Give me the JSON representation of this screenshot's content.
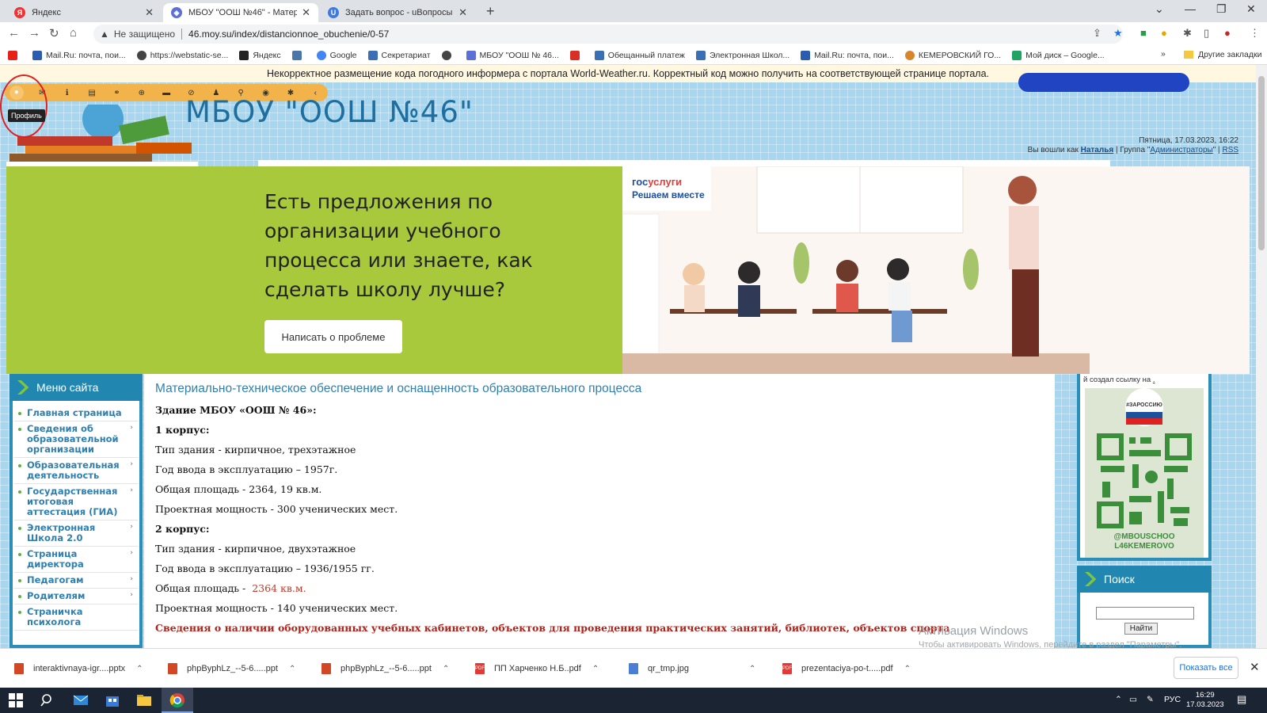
{
  "browser": {
    "tabs": [
      {
        "title": "Яндекс",
        "favicon": "yandex-icon",
        "color": "#e33"
      },
      {
        "title": "МБОУ \"ООШ №46\" - Материал...",
        "favicon": "site-icon",
        "color": "#5b6fd6"
      },
      {
        "title": "Задать вопрос - uВопросы",
        "favicon": "u-icon",
        "color": "#3d7be0"
      }
    ],
    "security_label": "Не защищено",
    "url": "46.moy.su/index/distancionnoe_obuchenie/0-57",
    "bookmarks": [
      "Mail.Ru: почта, пои...",
      "https://webstatic-se...",
      "Яндекс",
      "Google",
      "Секретариат",
      "МБОУ \"ООШ № 46...",
      "Обещанный платеж",
      "Электронная Школ...",
      "Mail.Ru: почта, пои...",
      "КЕМЕРОВСКИЙ ГО...",
      "Мой диск – Google..."
    ],
    "bookmarks_more": "»",
    "other_bookmarks": "Другие закладки"
  },
  "page": {
    "notice": "Некорректное размещение кода погодного информера с портала World-Weather.ru. Корректный код можно получить на соответствующей странице портала.",
    "tooltip": "Профиль",
    "site_title": "МБОУ \"ООШ №46\"",
    "datetime": "Пятница, 17.03.2023, 16:22",
    "login_prefix": "Вы вошли как",
    "user_name": "Наталья",
    "group_prefix": " | Группа \"",
    "group_name": "Администраторы",
    "group_suffix": "\" | ",
    "rss": "RSS",
    "banner": {
      "heading": "Есть предложения по организации учебного процесса или знаете, как сделать школу лучше?",
      "button": "Написать о проблеме",
      "gos_brand_a": "гос",
      "gos_brand_b": "услуги",
      "gos_sub": "Решаем вместе"
    },
    "menu": {
      "title": "Меню сайта",
      "items": [
        {
          "label": "Главная страница",
          "has_sub": false
        },
        {
          "label": "Сведения об образовательной организации",
          "has_sub": true
        },
        {
          "label": "Образовательная деятельность",
          "has_sub": true
        },
        {
          "label": "Государственная итоговая аттестация (ГИА)",
          "has_sub": true
        },
        {
          "label": "Электронная Школа 2.0",
          "has_sub": true
        },
        {
          "label": "Страница директора",
          "has_sub": true
        },
        {
          "label": "Педагогам",
          "has_sub": true
        },
        {
          "label": "Родителям",
          "has_sub": true
        },
        {
          "label": "Страничка психолога",
          "has_sub": false
        }
      ]
    },
    "content": {
      "title": "Материально-техническое обеспечение и оснащенность образовательного процесса",
      "lines": [
        {
          "text": "Здание МБОУ «ООШ № 46»:",
          "style": "b"
        },
        {
          "text": "1 корпус:",
          "style": "b"
        },
        {
          "text": "Тип здания - кирпичное, трехэтажное",
          "style": ""
        },
        {
          "text": "Год ввода в эксплуатацию – 1957г.",
          "style": ""
        },
        {
          "text": "Общая площадь -  2364, 19 кв.м.",
          "style": ""
        },
        {
          "text": "Проектная мощность - 300 ученических мест.",
          "style": ""
        },
        {
          "text": "2 корпус:",
          "style": "b"
        },
        {
          "text": "Тип здания - кирпичное, двухэтажное",
          "style": ""
        },
        {
          "text": "Год ввода в эксплуатацию – 1936/1955 гг.",
          "style": ""
        },
        {
          "text": "Общая площадь -  ",
          "style": "",
          "red_tail": "2364 кв.м."
        },
        {
          "text": "Проектная мощность - 140 ученических мест.",
          "style": ""
        },
        {
          "text": "Сведения о наличии оборудованных учебных кабинетов, объектов для проведения практических занятий, библиотек, объектов спорта",
          "style": "redbold"
        }
      ]
    },
    "right": {
      "qr_text": "й создал ссылку на",
      "qr_link": ".",
      "qr_tag": "#ЗАРОССИЮ",
      "qr_handle": "@MBOUSCHOO L46KEMEROVO",
      "search_title": "Поиск",
      "search_button": "Найти"
    },
    "watermark_1": "Активация Windows",
    "watermark_2": "Чтобы активировать Windows, перейдите в раздел \"Параметры\"."
  },
  "downloads": {
    "items": [
      {
        "name": "interaktivnaya-igr....pptx",
        "type": "ppt"
      },
      {
        "name": "phpByphLz_--5-6.....ppt",
        "type": "ppt"
      },
      {
        "name": "phpByphLz_--5-6.....ppt",
        "type": "ppt"
      },
      {
        "name": "ПП Харченко Н.Б..pdf",
        "type": "pdf"
      },
      {
        "name": "qr_tmp.jpg",
        "type": "img"
      },
      {
        "name": "prezentaciya-po-t.....pdf",
        "type": "pdf"
      }
    ],
    "show_all": "Показать все"
  },
  "taskbar": {
    "lang": "РУС",
    "time": "16:29",
    "date": "17.03.2023"
  }
}
